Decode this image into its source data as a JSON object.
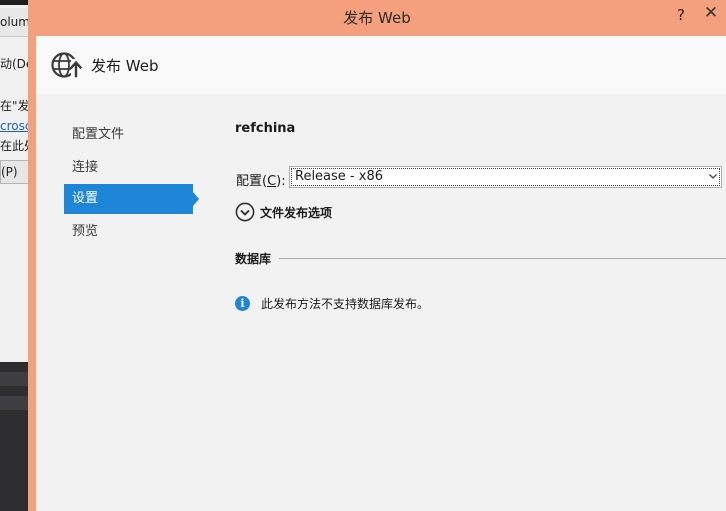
{
  "background_app": {
    "tab_label": "olum",
    "lines": [
      "动(De",
      "在\"发",
      "crosc",
      "在此处"
    ],
    "button_label": "(P)"
  },
  "dialog": {
    "title": "发布 Web",
    "help_glyph": "?",
    "close_glyph": "✕"
  },
  "header": {
    "title": "发布 Web",
    "icon": "globe-upload-icon"
  },
  "nav": {
    "items": [
      {
        "label": "配置文件",
        "selected": false
      },
      {
        "label": "连接",
        "selected": false
      },
      {
        "label": "设置",
        "selected": true
      },
      {
        "label": "预览",
        "selected": false
      }
    ]
  },
  "settings": {
    "profile_name": "refchina",
    "config_label_prefix": "配置(",
    "config_label_key": "C",
    "config_label_suffix": "):",
    "config_value": "Release - x86",
    "expander_label": "文件发布选项",
    "database_header": "数据库",
    "info_message": "此发布方法不支持数据库发布。"
  },
  "colors": {
    "accent": "#1e86d6",
    "dialog_border": "#f4a07d",
    "content_bg": "#f2f2f2"
  }
}
